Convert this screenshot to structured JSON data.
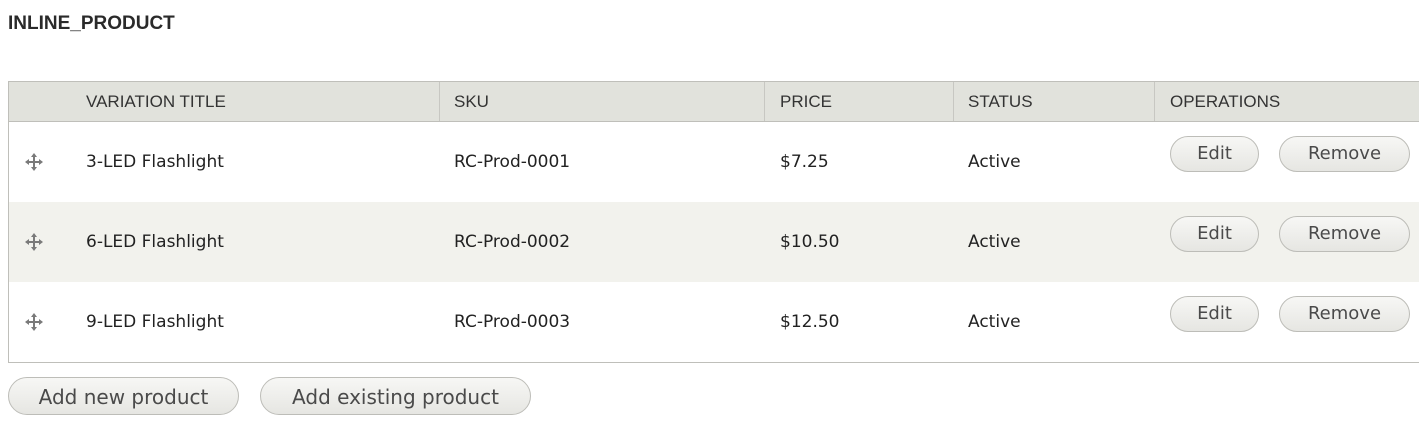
{
  "field": {
    "label": "INLINE_PRODUCT"
  },
  "table": {
    "headers": {
      "title": "VARIATION TITLE",
      "sku": "SKU",
      "price": "PRICE",
      "status": "STATUS",
      "operations": "OPERATIONS"
    },
    "rows": [
      {
        "title": "3-LED Flashlight",
        "sku": "RC-Prod-0001",
        "price": "$7.25",
        "status": "Active",
        "edit": "Edit",
        "remove": "Remove",
        "drag_icon": "drag-handle-icon"
      },
      {
        "title": "6-LED Flashlight",
        "sku": "RC-Prod-0002",
        "price": "$10.50",
        "status": "Active",
        "edit": "Edit",
        "remove": "Remove",
        "drag_icon": "drag-handle-icon"
      },
      {
        "title": "9-LED Flashlight",
        "sku": "RC-Prod-0003",
        "price": "$12.50",
        "status": "Active",
        "edit": "Edit",
        "remove": "Remove",
        "drag_icon": "drag-handle-icon"
      }
    ]
  },
  "actions": {
    "add_new": "Add new product",
    "add_existing": "Add existing product"
  },
  "colors": {
    "header_bg": "#e1e2dc",
    "stripe_bg": "#f2f2ed",
    "border": "#bfbfba"
  }
}
